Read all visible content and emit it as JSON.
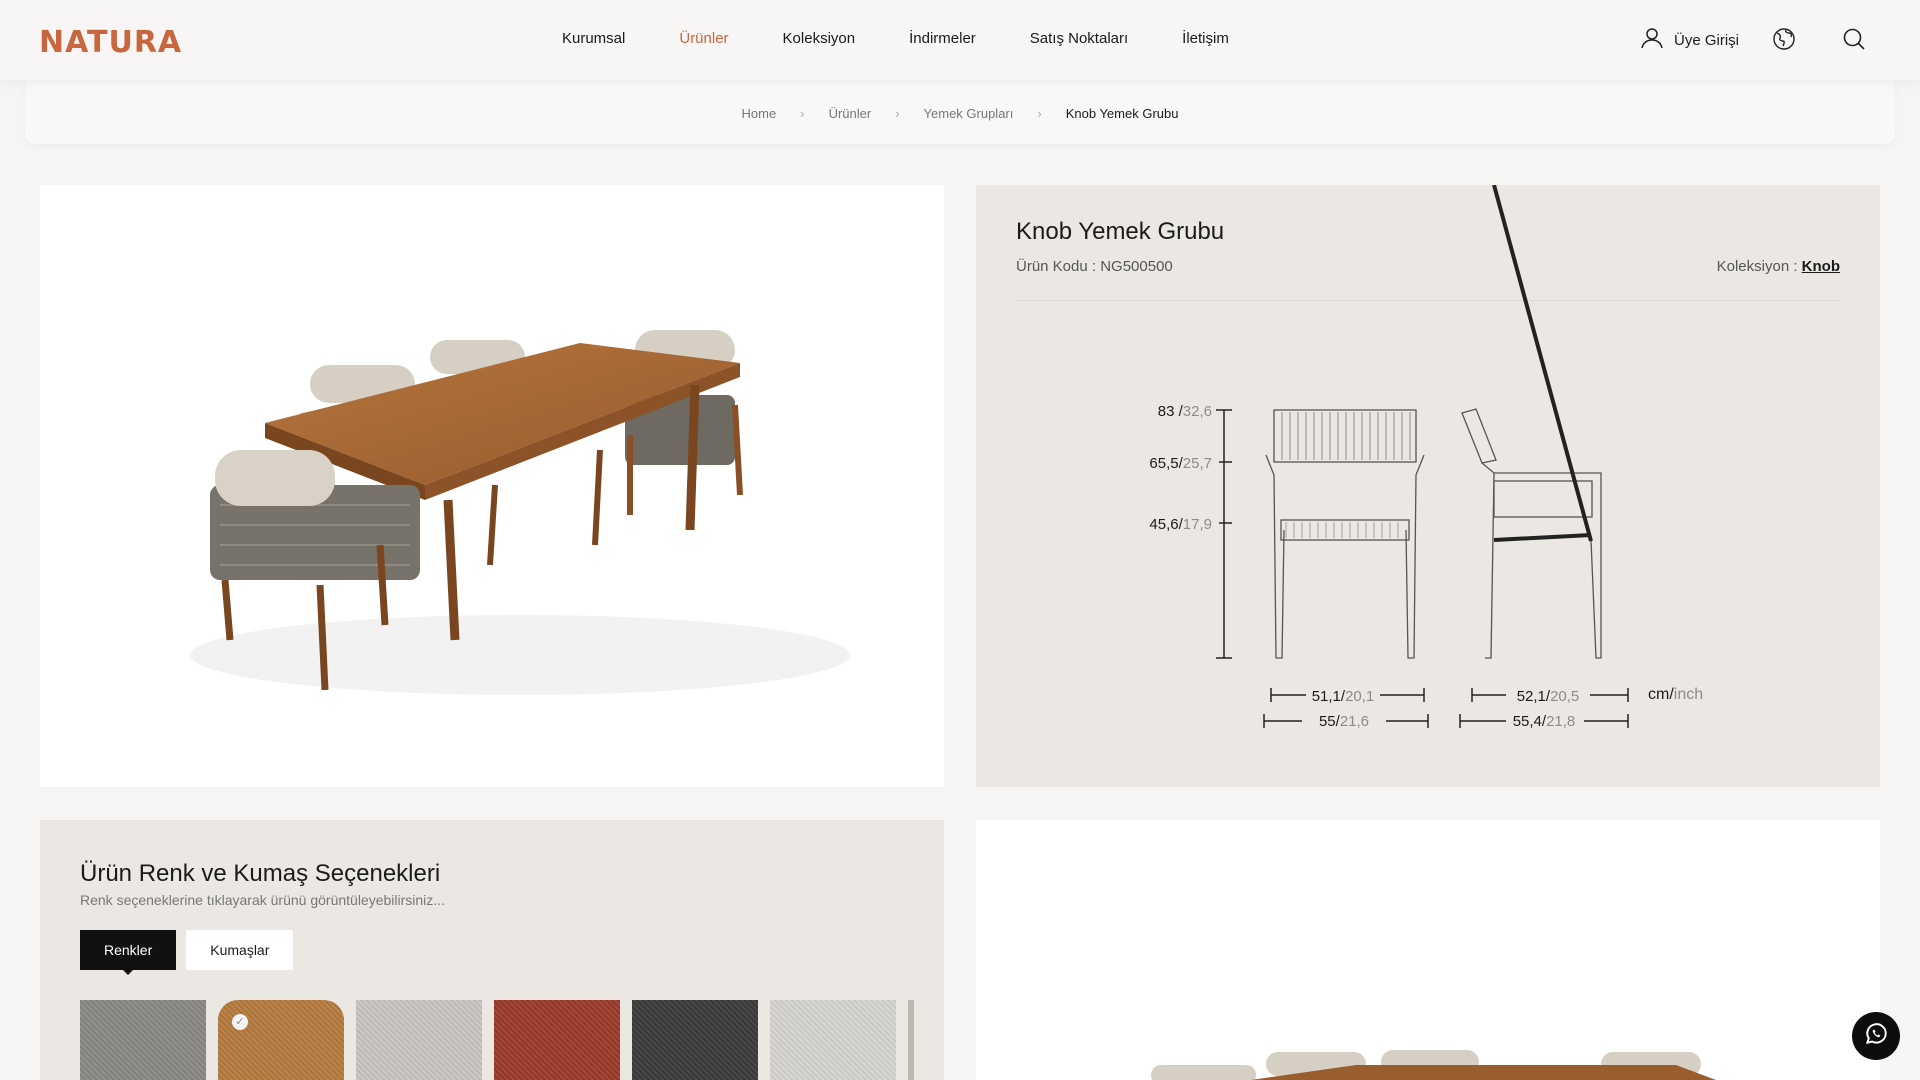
{
  "brand": {
    "logo_text": "NATURA",
    "accent_color": "#c8663f"
  },
  "nav": {
    "items": [
      {
        "label": "Kurumsal",
        "active": false
      },
      {
        "label": "Ürünler",
        "active": true
      },
      {
        "label": "Koleksiyon",
        "active": false
      },
      {
        "label": "İndirmeler",
        "active": false
      },
      {
        "label": "Satış Noktaları",
        "active": false
      },
      {
        "label": "İletişim",
        "active": false
      }
    ],
    "login_label": "Üye Girişi",
    "icons": [
      "user-icon",
      "globe-icon",
      "search-icon"
    ]
  },
  "breadcrumb": [
    "Home",
    "Ürünler",
    "Yemek Grupları",
    "Knob Yemek Grubu"
  ],
  "product": {
    "title": "Knob Yemek Grubu",
    "code_label": "Ürün Kodu : ",
    "code": "NG500500",
    "collection_label": "Koleksiyon : ",
    "collection": "Knob"
  },
  "dimensions": {
    "heights": [
      {
        "cm": "83",
        "inch": "32,6"
      },
      {
        "cm": "65,5",
        "inch": "25,7"
      },
      {
        "cm": "45,6",
        "inch": "17,9"
      }
    ],
    "front_widths": [
      {
        "cm": "51,1",
        "inch": "20,1"
      },
      {
        "cm": "55",
        "inch": "21,6"
      }
    ],
    "side_widths": [
      {
        "cm": "52,1",
        "inch": "20,5"
      },
      {
        "cm": "55,4",
        "inch": "21,8"
      }
    ],
    "unit_cm": "cm",
    "unit_inch": "inch"
  },
  "options": {
    "title": "Ürün Renk ve Kumaş Seçenekleri",
    "subtitle": "Renk seçeneklerine tıklayarak ürünü görüntüleyebilirsiniz...",
    "tabs": [
      {
        "label": "Renkler",
        "active": true
      },
      {
        "label": "Kumaşlar",
        "active": false
      }
    ],
    "swatch_colors": [
      "#8a8884",
      "#b57a3e",
      "#c9c6c0",
      "#9b3a28",
      "#3a3a3a",
      "#d6d4ce"
    ],
    "selected_swatch": 1
  }
}
